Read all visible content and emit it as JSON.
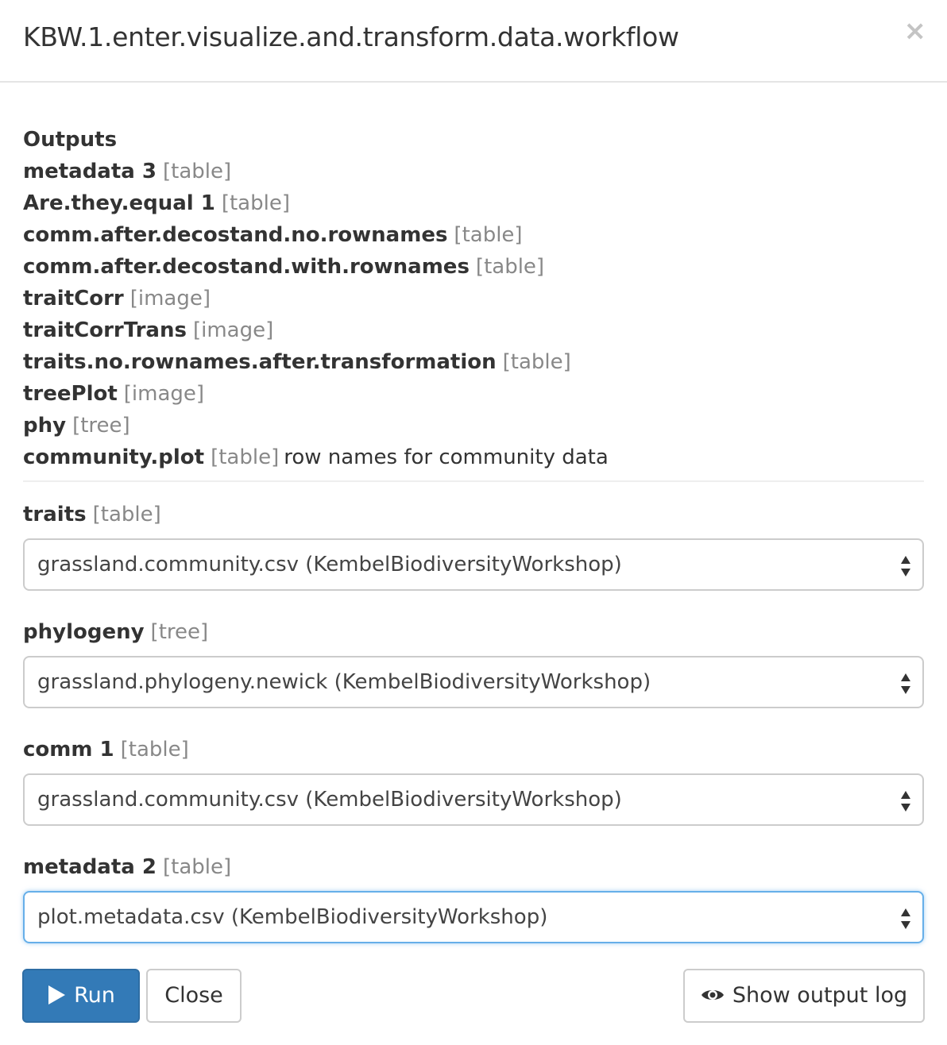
{
  "modal": {
    "title": "KBW.1.enter.visualize.and.transform.data.workflow",
    "close_symbol": "×"
  },
  "outputs": {
    "heading": "Outputs",
    "items": [
      {
        "name": "metadata 3",
        "type": "[table]",
        "description": ""
      },
      {
        "name": "Are.they.equal 1",
        "type": "[table]",
        "description": ""
      },
      {
        "name": "comm.after.decostand.no.rownames",
        "type": "[table]",
        "description": ""
      },
      {
        "name": "comm.after.decostand.with.rownames",
        "type": "[table]",
        "description": ""
      },
      {
        "name": "traitCorr",
        "type": "[image]",
        "description": ""
      },
      {
        "name": "traitCorrTrans",
        "type": "[image]",
        "description": ""
      },
      {
        "name": "traits.no.rownames.after.transformation",
        "type": "[table]",
        "description": ""
      },
      {
        "name": "treePlot",
        "type": "[image]",
        "description": ""
      },
      {
        "name": "phy",
        "type": "[tree]",
        "description": ""
      },
      {
        "name": "community.plot",
        "type": "[table]",
        "description": "row names for community data"
      }
    ]
  },
  "inputs": [
    {
      "label": "traits",
      "type": "[table]",
      "value": "grassland.community.csv (KembelBiodiversityWorkshop)"
    },
    {
      "label": "phylogeny",
      "type": "[tree]",
      "value": "grassland.phylogeny.newick (KembelBiodiversityWorkshop)"
    },
    {
      "label": "comm 1",
      "type": "[table]",
      "value": "grassland.community.csv (KembelBiodiversityWorkshop)"
    },
    {
      "label": "metadata 2",
      "type": "[table]",
      "value": "plot.metadata.csv (KembelBiodiversityWorkshop)"
    }
  ],
  "buttons": {
    "run": "Run",
    "close": "Close",
    "show_log": "Show output log"
  },
  "colors": {
    "primary": "#337ab7",
    "focus": "#66afe9",
    "muted": "#888888"
  },
  "icons": {
    "run": "play-icon",
    "show_log": "eye-icon",
    "select": "up-down-arrows-icon"
  }
}
